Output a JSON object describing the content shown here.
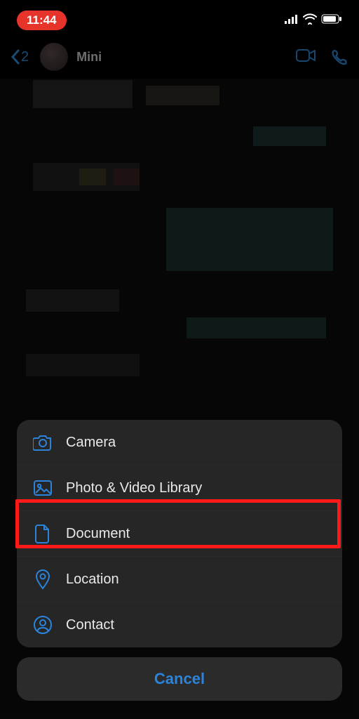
{
  "status": {
    "time": "11:44"
  },
  "header": {
    "back_count": "2",
    "contact_name": "Mini"
  },
  "sheet": {
    "items": [
      {
        "id": "camera",
        "label": "Camera"
      },
      {
        "id": "library",
        "label": "Photo & Video Library"
      },
      {
        "id": "document",
        "label": "Document"
      },
      {
        "id": "location",
        "label": "Location"
      },
      {
        "id": "contact",
        "label": "Contact"
      }
    ],
    "cancel_label": "Cancel"
  },
  "annotation": {
    "highlighted_item": "document"
  }
}
